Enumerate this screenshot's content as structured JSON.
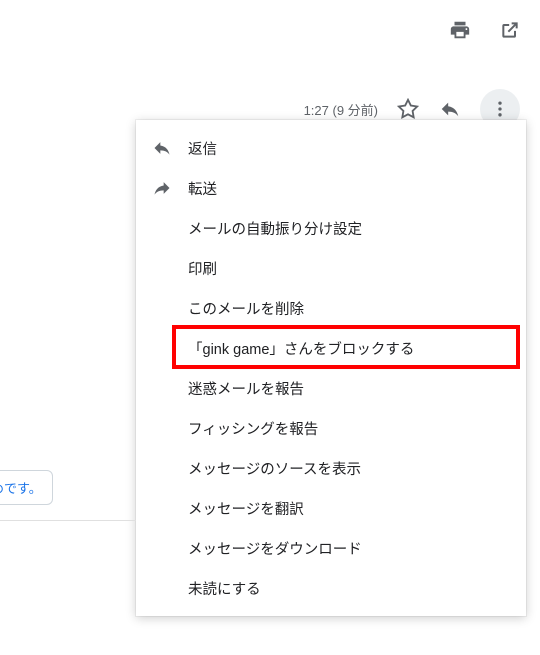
{
  "top": {
    "timestamp": "1:27 (9 分前)"
  },
  "menu": {
    "reply": "返信",
    "forward": "転送",
    "filter": "メールの自動振り分け設定",
    "print": "印刷",
    "delete": "このメールを削除",
    "block": "「gink game」さんをブロックする",
    "spam": "迷惑メールを報告",
    "phishing": "フィッシングを報告",
    "show_original": "メッセージのソースを表示",
    "translate": "メッセージを翻訳",
    "download": "メッセージをダウンロード",
    "mark_unread": "未読にする"
  },
  "partial_text": "めです。"
}
